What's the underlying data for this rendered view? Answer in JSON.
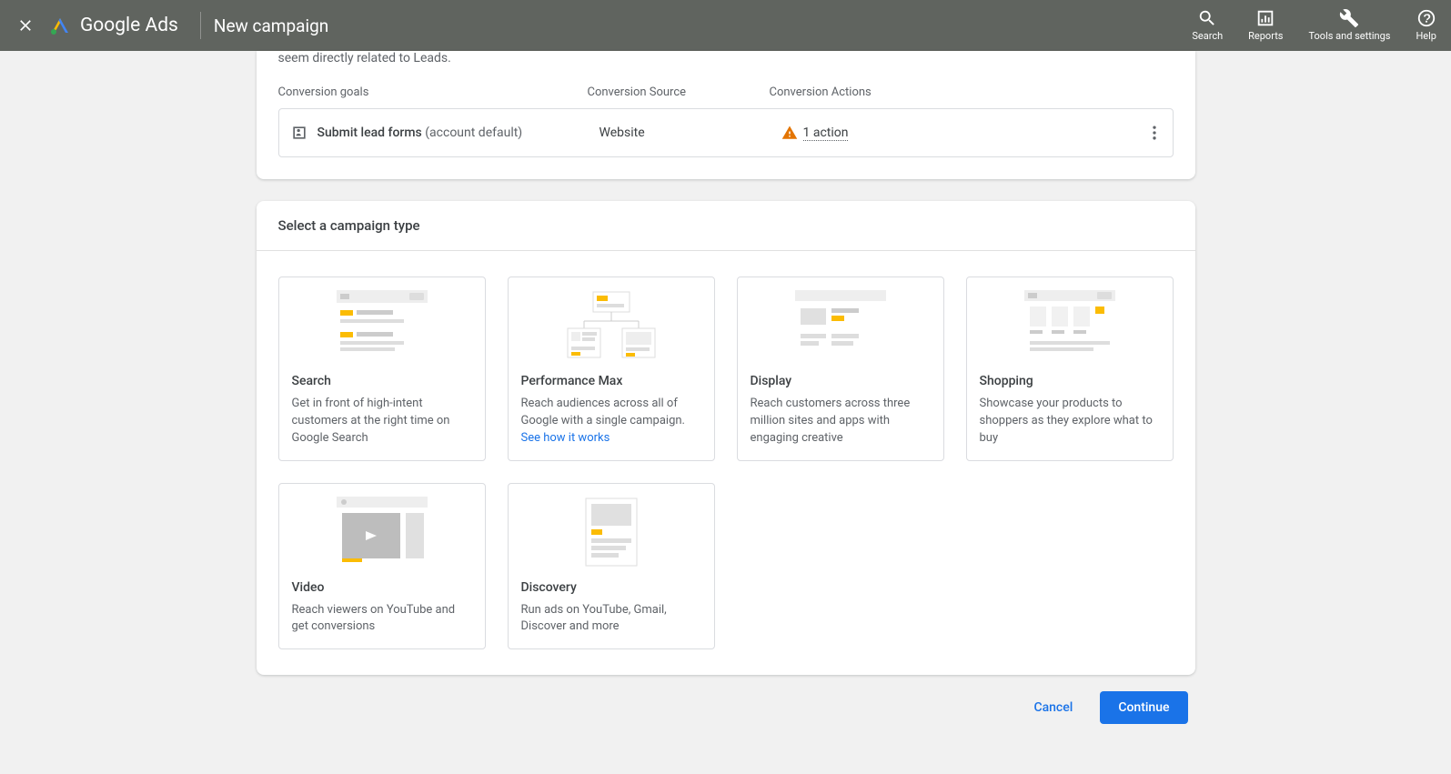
{
  "header": {
    "brand": "Google Ads",
    "title": "New campaign",
    "tools": {
      "search": "Search",
      "reports": "Reports",
      "tools_settings": "Tools and settings",
      "help": "Help"
    }
  },
  "goals": {
    "intro_fragment": "seem directly related to Leads.",
    "columns": {
      "goal": "Conversion goals",
      "source": "Conversion Source",
      "actions": "Conversion Actions"
    },
    "row": {
      "name": "Submit lead forms",
      "sub": "(account default)",
      "source": "Website",
      "actions": "1 action"
    }
  },
  "campaign_types": {
    "title": "Select a campaign type",
    "options": [
      {
        "name": "Search",
        "desc": "Get in front of high-intent customers at the right time on Google Search",
        "link": ""
      },
      {
        "name": "Performance Max",
        "desc": "Reach audiences across all of Google with a single campaign. ",
        "link": "See how it works"
      },
      {
        "name": "Display",
        "desc": "Reach customers across three million sites and apps with engaging creative",
        "link": ""
      },
      {
        "name": "Shopping",
        "desc": "Showcase your products to shoppers as they explore what to buy",
        "link": ""
      },
      {
        "name": "Video",
        "desc": "Reach viewers on YouTube and get conversions",
        "link": ""
      },
      {
        "name": "Discovery",
        "desc": "Run ads on YouTube, Gmail, Discover and more",
        "link": ""
      }
    ]
  },
  "footer": {
    "cancel": "Cancel",
    "continue": "Continue"
  }
}
